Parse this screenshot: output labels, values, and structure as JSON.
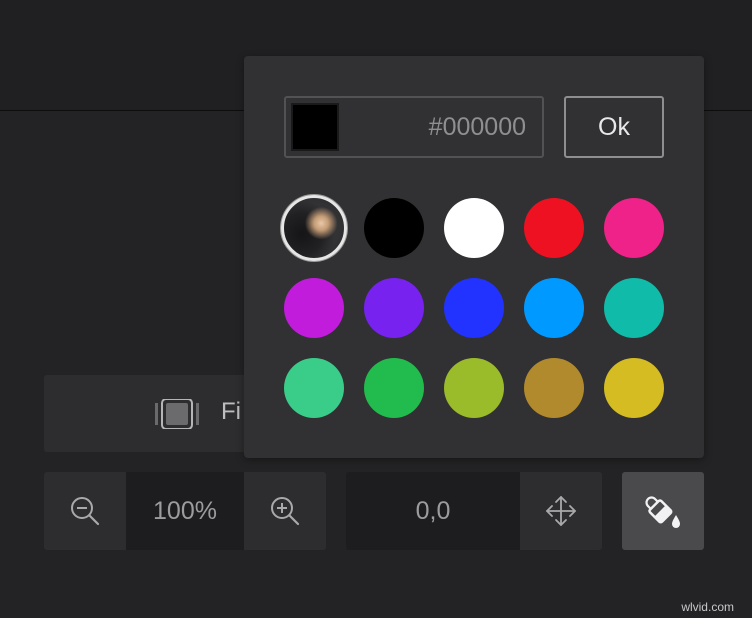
{
  "fit_button": {
    "label": "Fi"
  },
  "zoom": {
    "value": "100%"
  },
  "position": {
    "value": "0,0"
  },
  "color_picker": {
    "hex_value": "#000000",
    "ok_label": "Ok",
    "swatches": [
      {
        "name": "custom-image",
        "color": "#2a2a2c"
      },
      {
        "name": "black",
        "color": "#000000"
      },
      {
        "name": "white",
        "color": "#ffffff"
      },
      {
        "name": "red",
        "color": "#ee1122"
      },
      {
        "name": "pink",
        "color": "#ee2288"
      },
      {
        "name": "magenta",
        "color": "#c11bdc"
      },
      {
        "name": "violet",
        "color": "#7722ee"
      },
      {
        "name": "blue",
        "color": "#2233ff"
      },
      {
        "name": "sky-blue",
        "color": "#0099ff"
      },
      {
        "name": "teal",
        "color": "#11bbaa"
      },
      {
        "name": "mint",
        "color": "#3acd8a"
      },
      {
        "name": "green",
        "color": "#22bb4d"
      },
      {
        "name": "lime",
        "color": "#9abb2a"
      },
      {
        "name": "ochre",
        "color": "#b08a2c"
      },
      {
        "name": "mustard",
        "color": "#d4bc22"
      }
    ]
  },
  "icons": {
    "fit": "fit-frame-icon",
    "zoom_out": "magnifier-minus-icon",
    "zoom_in": "magnifier-plus-icon",
    "move": "move-arrows-icon",
    "fill": "paint-bucket-icon"
  },
  "watermark": "wlvid.com"
}
